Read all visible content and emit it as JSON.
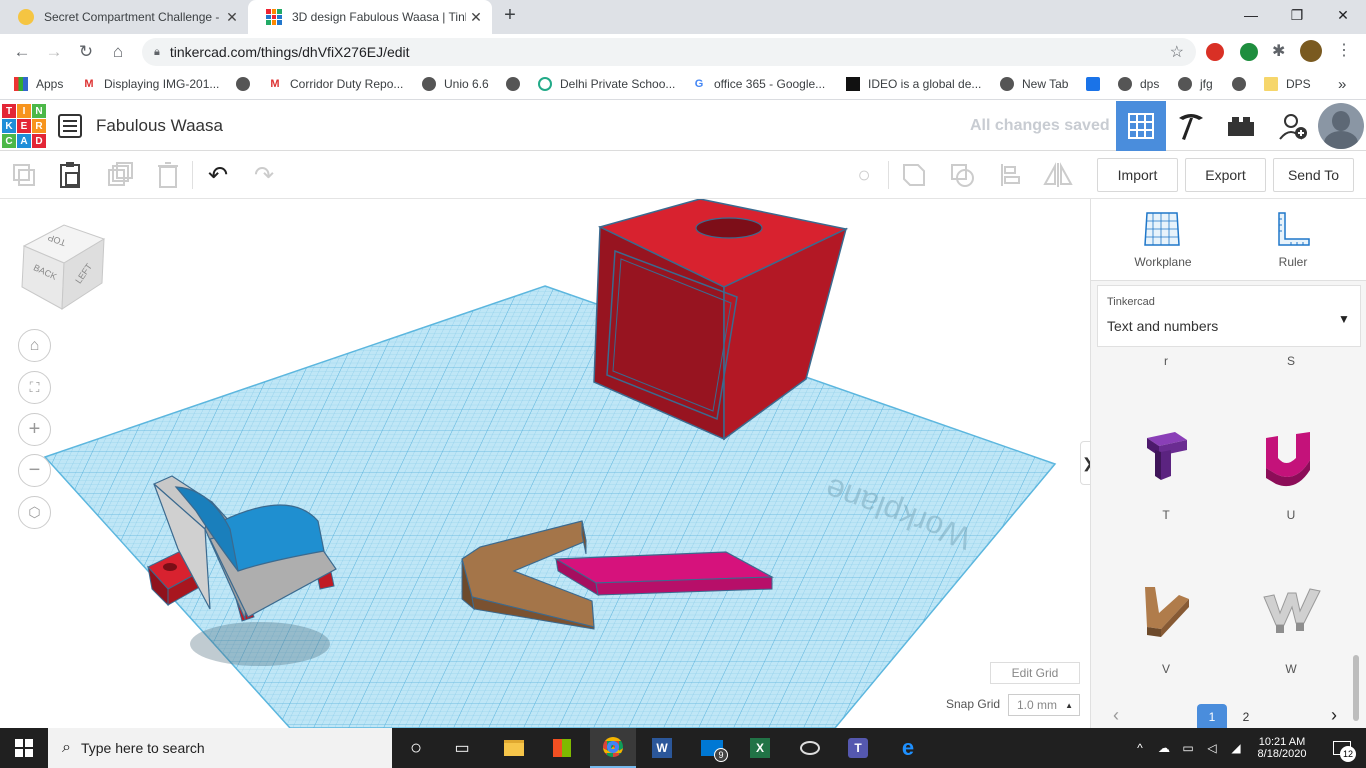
{
  "browser": {
    "tabs": [
      {
        "title": "Secret Compartment Challenge -",
        "close": "✕"
      },
      {
        "title": "3D design Fabulous Waasa | Tink",
        "close": "✕"
      }
    ],
    "new_tab": "+",
    "window": {
      "minimize": "—",
      "maximize": "❐",
      "close": "✕"
    },
    "url": "tinkercad.com/things/dhVfiX276EJ/edit",
    "bookmarks": [
      {
        "label": "Apps",
        "icon": "apps-grid-icon"
      },
      {
        "label": "Displaying IMG-201...",
        "icon": "gmail-icon"
      },
      {
        "label": "",
        "icon": "globe-icon"
      },
      {
        "label": "Corridor Duty Repo...",
        "icon": "gmail-icon"
      },
      {
        "label": "Unio 6.6",
        "icon": "globe-icon"
      },
      {
        "label": "",
        "icon": "globe-icon"
      },
      {
        "label": "Delhi Private Schoo...",
        "icon": "school-icon"
      },
      {
        "label": "office 365 - Google...",
        "icon": "google-icon"
      },
      {
        "label": "IDEO is a global de...",
        "icon": "ideo-icon"
      },
      {
        "label": "New Tab",
        "icon": "globe-icon"
      },
      {
        "label": "",
        "icon": "bookmark-app-icon"
      },
      {
        "label": "dps",
        "icon": "globe-icon"
      },
      {
        "label": "jfg",
        "icon": "globe-icon"
      },
      {
        "label": "",
        "icon": "globe-icon"
      },
      {
        "label": "DPS",
        "icon": "folder-icon"
      }
    ],
    "more": "»"
  },
  "tinkercad": {
    "logo": [
      "T",
      "I",
      "N",
      "K",
      "E",
      "R",
      "C",
      "A",
      "D"
    ],
    "design_name": "Fabulous Waasa",
    "save_status": "All changes saved",
    "toolbar": {
      "import_label": "Import",
      "export_label": "Export",
      "send_to_label": "Send To"
    },
    "view_cube": {
      "top": "TOP",
      "back": "BACK",
      "left": "LEFT"
    },
    "workplane_text": "Workplane",
    "edit_grid_label": "Edit Grid",
    "snap_grid_label": "Snap Grid",
    "snap_grid_value": "1.0 mm",
    "collapse_arrow": "❯",
    "panel": {
      "workplane_label": "Workplane",
      "ruler_label": "Ruler",
      "library_source": "Tinkercad",
      "library_name": "Text and numbers",
      "partial_labels": [
        "r",
        "S"
      ],
      "shapes": [
        {
          "label": "T",
          "color": "#6a2c91"
        },
        {
          "label": "U",
          "color": "#c4127a"
        },
        {
          "label": "V",
          "color": "#9b6536"
        },
        {
          "label": "W",
          "color": "#b8b8b8"
        }
      ],
      "pages": [
        "1",
        "2"
      ],
      "prev": "‹",
      "next": "›"
    }
  },
  "taskbar": {
    "search_placeholder": "Type here to search",
    "time": "10:21 AM",
    "date": "8/18/2020",
    "notifications": "12",
    "mail_badge": "9"
  },
  "colors": {
    "grid_blue": "#8fd3ee",
    "box_red": "#a01020",
    "chair_gray": "#b5b5b5",
    "chair_blue": "#1c8fd0",
    "v_brown": "#a47549",
    "plate_pink": "#d6127c",
    "tinkercad_accent": "#4a8ddc"
  }
}
